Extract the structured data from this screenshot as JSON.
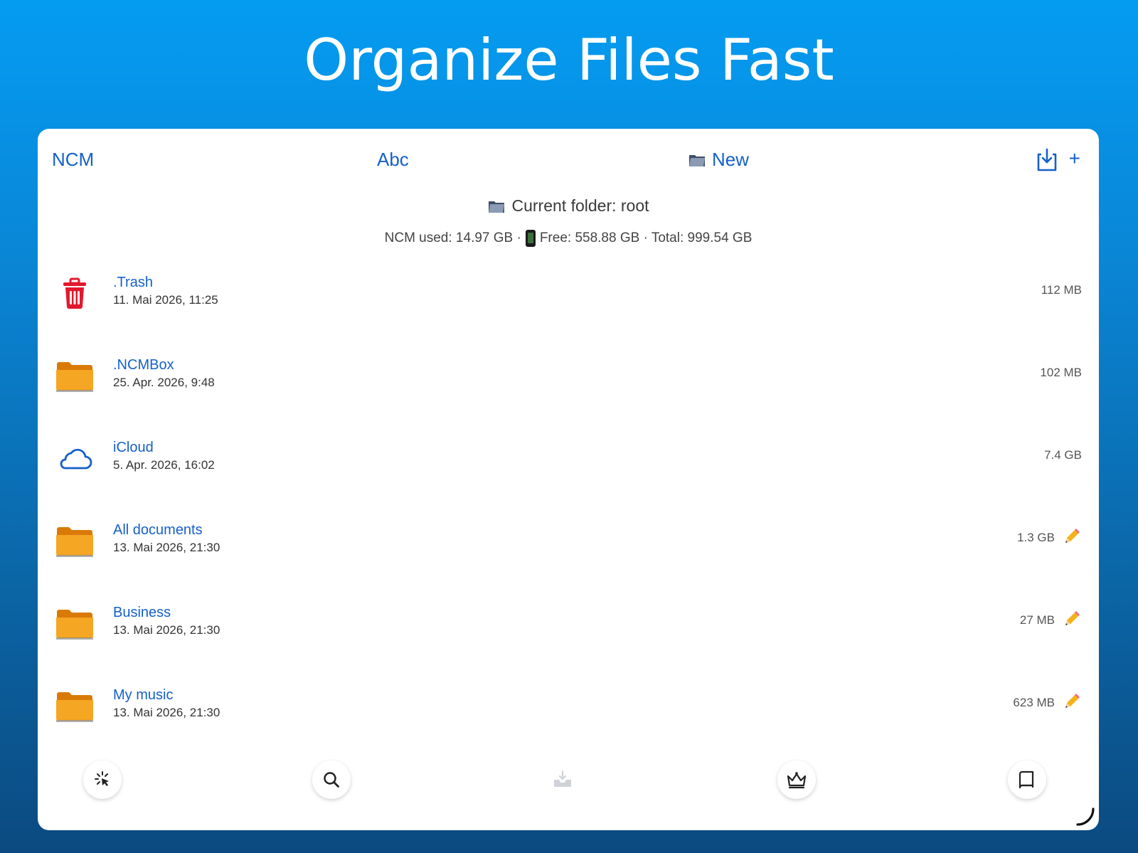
{
  "hero": {
    "title": "Organize Files Fast"
  },
  "toolbar": {
    "ncm_label": "NCM",
    "sort_label": "Abc",
    "new_label": "New",
    "plus_label": "+"
  },
  "folder_info": {
    "current_folder": "Current folder: root",
    "ncm_used": "NCM used: 14.97 GB ·",
    "free_total": "Free: 558.88 GB · Total: 999.54 GB"
  },
  "files": [
    {
      "name": ".Trash",
      "date": "11. Mai 2026, 11:25",
      "size": "112 MB",
      "icon": "trash-icon"
    },
    {
      "name": ".NCMBox",
      "date": "25. Apr. 2026, 9:48",
      "size": "102 MB",
      "icon": "folder-icon"
    },
    {
      "name": "iCloud",
      "date": "5. Apr. 2026, 16:02",
      "size": "7.4 GB",
      "icon": "cloud-icon"
    },
    {
      "name": "All documents",
      "date": "13. Mai 2026, 21:30",
      "size": "1.3 GB",
      "icon": "folder-icon",
      "editable": true
    },
    {
      "name": "Business",
      "date": "13. Mai 2026, 21:30",
      "size": "27 MB",
      "icon": "folder-icon",
      "editable": true
    },
    {
      "name": "My music",
      "date": "13. Mai 2026, 21:30",
      "size": "623 MB",
      "icon": "folder-icon",
      "editable": true
    }
  ],
  "bottom_bar": [
    "select-icon",
    "search-icon",
    "import-tray-icon",
    "crown-icon",
    "book-icon"
  ],
  "colors": {
    "accent": "#1560c9",
    "folder": "#f39a1a",
    "trash": "#e3182d",
    "bg_top": "#049cf2",
    "bg_bottom": "#0b4a80"
  }
}
